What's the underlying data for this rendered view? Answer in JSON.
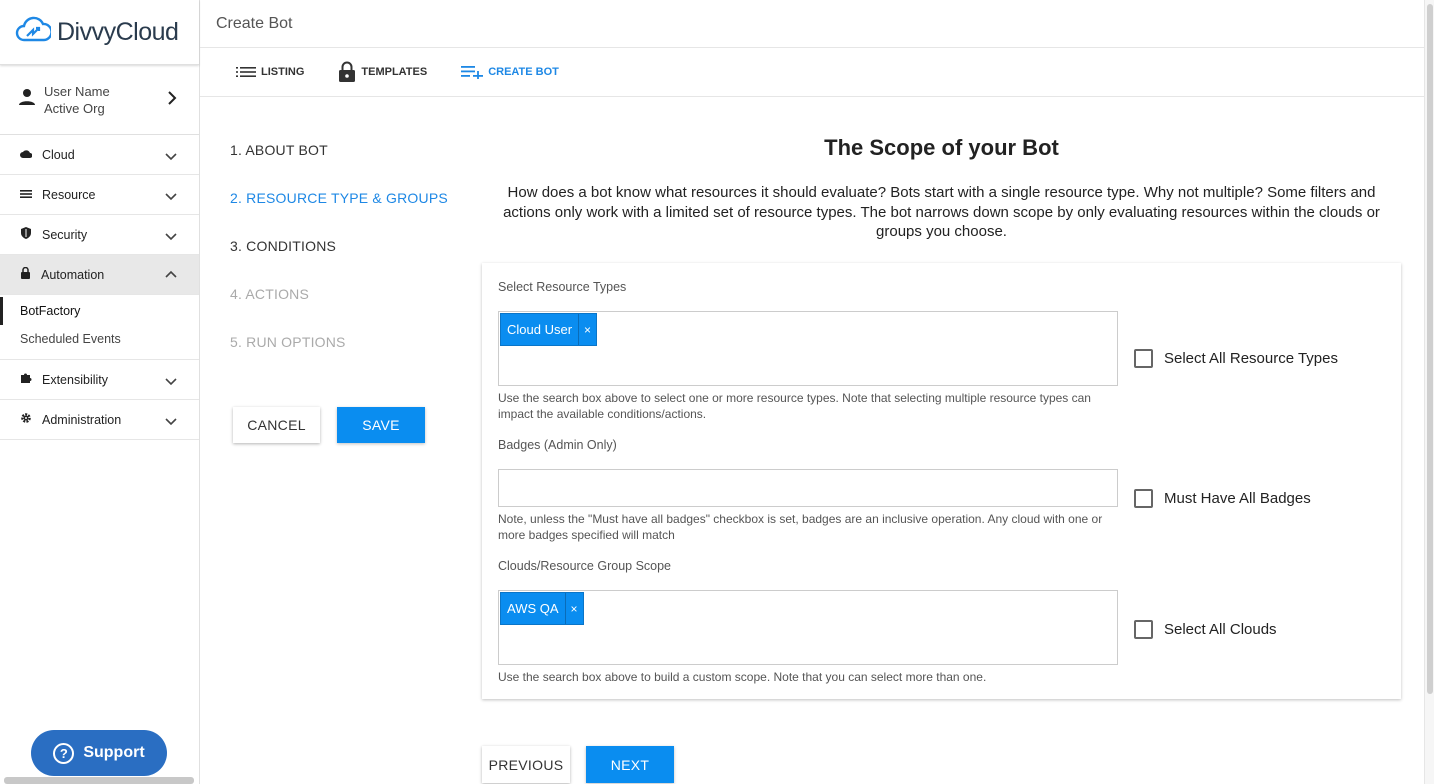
{
  "sidebar": {
    "logo_text": "DivvyCloud",
    "user_name": "User Name",
    "active_org": "Active Org",
    "nav": [
      {
        "label": "Cloud",
        "icon": "cloud-icon"
      },
      {
        "label": "Resource",
        "icon": "list-icon"
      },
      {
        "label": "Security",
        "icon": "shield-icon"
      },
      {
        "label": "Automation",
        "icon": "lock-icon"
      },
      {
        "label": "Extensibility",
        "icon": "puzzle-icon"
      },
      {
        "label": "Administration",
        "icon": "gear-icon"
      }
    ],
    "automation_sub": [
      "BotFactory",
      "Scheduled Events"
    ],
    "support_label": "Support"
  },
  "header": {
    "title": "Create Bot",
    "tabs": [
      {
        "label": "LISTING"
      },
      {
        "label": "TEMPLATES"
      },
      {
        "label": "CREATE BOT"
      }
    ]
  },
  "steps": [
    "1. ABOUT BOT",
    "2. RESOURCE TYPE & GROUPS",
    "3. CONDITIONS",
    "4. ACTIONS",
    "5. RUN OPTIONS"
  ],
  "buttons": {
    "cancel": "CANCEL",
    "save": "SAVE",
    "previous": "PREVIOUS",
    "next": "NEXT"
  },
  "main": {
    "title": "The Scope of your Bot",
    "description": "How does a bot know what resources it should evaluate? Bots start with a single resource type. Why not multiple? Some filters and actions only work with a limited set of resource types. The bot narrows down scope by only evaluating resources within the clouds or groups you choose."
  },
  "form": {
    "resource_types": {
      "label": "Select Resource Types",
      "chips": [
        "Cloud User"
      ],
      "hint": "Use the search box above to select one or more resource types. Note that selecting multiple resource types can impact the available conditions/actions.",
      "checkbox": "Select All Resource Types"
    },
    "badges": {
      "label": "Badges (Admin Only)",
      "hint": "Note, unless the \"Must have all badges\" checkbox is set, badges are an inclusive operation. Any cloud with one or more badges specified will match",
      "checkbox": "Must Have All Badges"
    },
    "scope": {
      "label": "Clouds/Resource Group Scope",
      "chips": [
        "AWS QA"
      ],
      "hint": "Use the search box above to build a custom scope. Note that you can select more than one.",
      "checkbox": "Select All Clouds"
    },
    "chip_remove": "×"
  }
}
